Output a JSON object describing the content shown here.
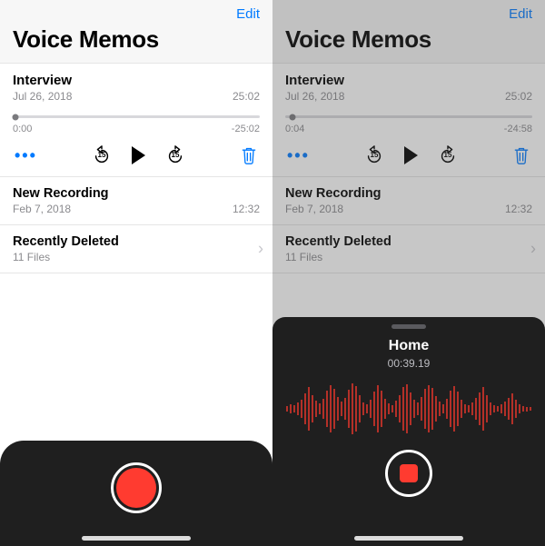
{
  "left": {
    "edit": "Edit",
    "title": "Voice Memos",
    "expanded": {
      "title": "Interview",
      "date": "Jul 26, 2018",
      "duration": "25:02",
      "elapsed": "0:00",
      "remaining": "-25:02",
      "skip_seconds": "15",
      "progress_pct": 1
    },
    "recording2": {
      "title": "New Recording",
      "date": "Feb 7, 2018",
      "duration": "12:32"
    },
    "deleted": {
      "title": "Recently Deleted",
      "subtitle": "11 Files"
    }
  },
  "right": {
    "edit": "Edit",
    "title": "Voice Memos",
    "expanded": {
      "title": "Interview",
      "date": "Jul 26, 2018",
      "duration": "25:02",
      "elapsed": "0:04",
      "remaining": "-24:58",
      "skip_seconds": "15",
      "progress_pct": 3
    },
    "recording2": {
      "title": "New Recording",
      "date": "Feb 7, 2018",
      "duration": "12:32"
    },
    "deleted": {
      "title": "Recently Deleted",
      "subtitle": "11 Files"
    },
    "sheet": {
      "title": "Home",
      "time": "00:39.19"
    }
  }
}
